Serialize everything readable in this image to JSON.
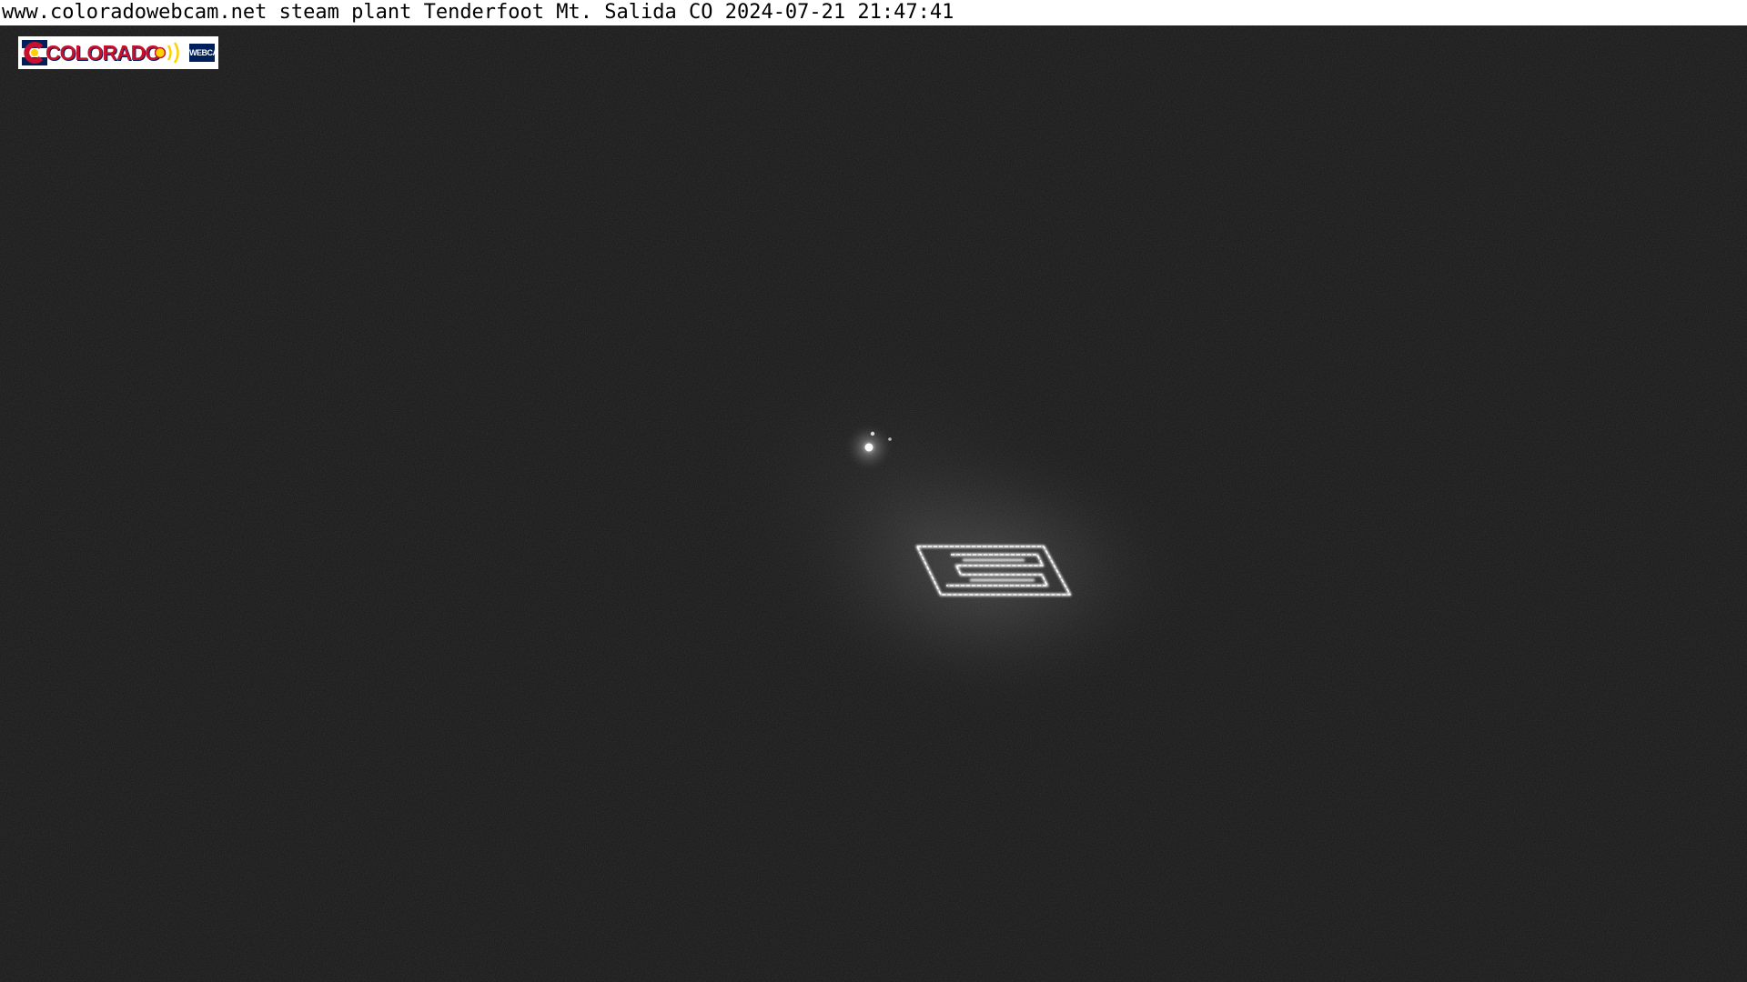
{
  "overlay": {
    "caption": "www.coloradowebcam.net steam plant Tenderfoot Mt. Salida CO 2024-07-21 21:47:41"
  },
  "logo": {
    "word": "COLORADO",
    "badge": "WEBCAM",
    "colors": {
      "red": "#c8102e",
      "blue": "#00205b",
      "gold": "#ffd100",
      "white": "#ffffff"
    }
  },
  "scene": {
    "sky_color": "#151515",
    "light_color": "#ffffff"
  }
}
